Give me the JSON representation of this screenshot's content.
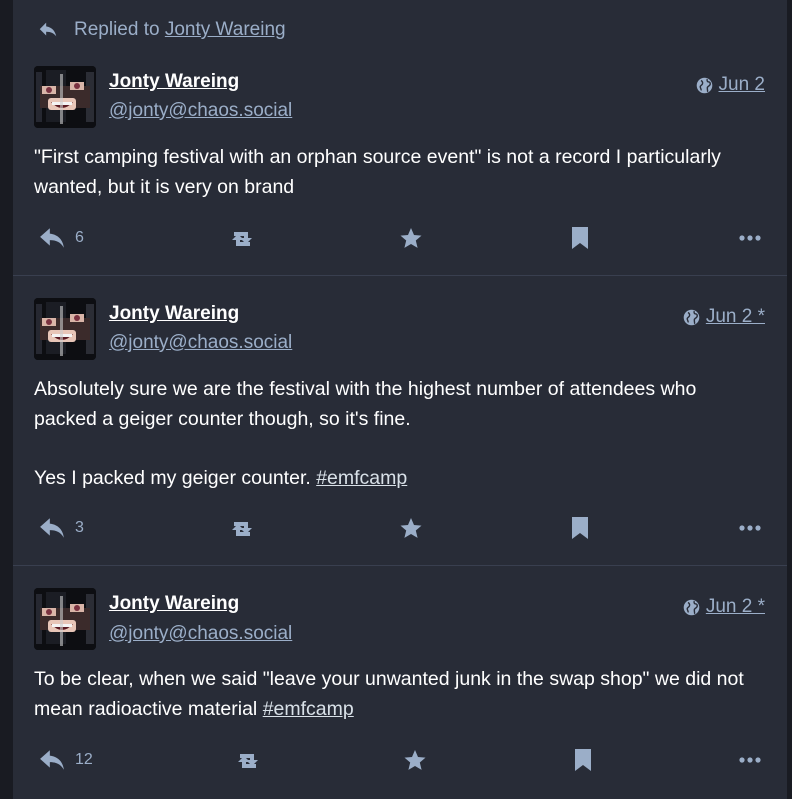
{
  "reply_hint": {
    "prefix": "Replied to",
    "target": "Jonty Wareing"
  },
  "statuses": [
    {
      "display_name": "Jonty Wareing",
      "handle": "@jonty@chaos.social",
      "timestamp": "Jun 2",
      "content": [
        "\"First camping festival with an orphan source event\" is not a record I particularly wanted, but it is very on brand"
      ],
      "hashtag": "",
      "replies": "6"
    },
    {
      "display_name": "Jonty Wareing",
      "handle": "@jonty@chaos.social",
      "timestamp": "Jun 2 *",
      "content": [
        "Absolutely sure we are the festival with the highest number of attendees who packed a geiger counter though, so it's fine.",
        "Yes I packed my geiger counter."
      ],
      "hashtag": "#emfcamp",
      "replies": "3"
    },
    {
      "display_name": "Jonty Wareing",
      "handle": "@jonty@chaos.social",
      "timestamp": "Jun 2 *",
      "content": [
        "To be clear, when we said \"leave your unwanted junk in the swap shop\" we did not mean radioactive material"
      ],
      "hashtag": "#emfcamp",
      "replies": "12"
    }
  ],
  "colors": {
    "background": "#191b22",
    "column": "#282c37",
    "secondary_text": "#9baec8",
    "primary_text": "#ffffff"
  },
  "icons": [
    "reply-icon",
    "boost-icon",
    "favourite-icon",
    "bookmark-icon",
    "more-icon",
    "globe-icon"
  ]
}
